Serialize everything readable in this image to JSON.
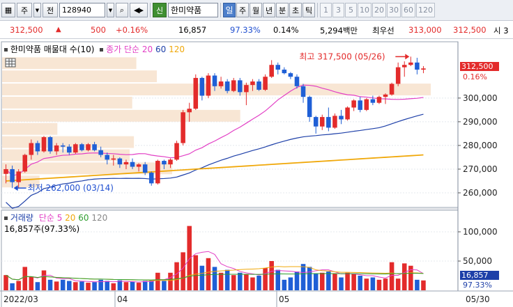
{
  "toolbar": {
    "type_label": "주",
    "jeon_label": "전",
    "code_value": "128940",
    "shin_label": "신",
    "stock_name": "한미약품",
    "periods": [
      "일",
      "주",
      "월",
      "년",
      "분",
      "초",
      "틱"
    ],
    "active_period": "일",
    "intervals": [
      "1",
      "3",
      "5",
      "10",
      "20",
      "30",
      "60",
      "120"
    ]
  },
  "quote": {
    "price": "312,500",
    "change": "500",
    "change_pct": "+0.16%",
    "volume": "16,857",
    "vol_ratio": "97.33%",
    "turnover": "0.14%",
    "amount": "5,294백만",
    "best_bid_label": "최우선",
    "best_ask": "313,000",
    "best_bid": "312,500",
    "extra": "시 3"
  },
  "price_panel": {
    "legend_title": "한미약품 매물대 수(10)",
    "ma_label": "종가 단순",
    "ma_periods": [
      "20",
      "60",
      "120"
    ],
    "ma_colors": [
      "#e23fc5",
      "#1d3fa8",
      "#f0a80a"
    ],
    "high_label": "최고 317,500 (05/26)",
    "low_label": "최저 262,000 (03/14)",
    "current_price": "312,500",
    "current_pct": "0.16%",
    "y_ticks": [
      "300,000",
      "290,000",
      "280,000",
      "270,000",
      "260,000"
    ]
  },
  "volume_panel": {
    "legend_title": "거래량",
    "ma_label": "단순",
    "ma_periods": [
      "5",
      "20",
      "60",
      "120"
    ],
    "ma_colors": [
      "#e23fc5",
      "#f0a80a",
      "#2f9e2f",
      "#888888"
    ],
    "current_text": "16,857주(97.33%)",
    "current_volume": "16,857",
    "current_pct": "97.33%",
    "y_ticks": [
      "100,000",
      "50,000"
    ]
  },
  "x_axis": {
    "labels": [
      "2022/03",
      "04",
      "05"
    ],
    "right_label": "05/30"
  },
  "chart_data": {
    "type": "candlestick",
    "ylim": [
      255000,
      322000
    ],
    "volume_ylim": [
      0,
      125000
    ],
    "candles": [
      [
        268000,
        272000,
        264000,
        270000,
        26000
      ],
      [
        270000,
        271500,
        262000,
        264500,
        12000
      ],
      [
        264500,
        270000,
        262000,
        269000,
        16000
      ],
      [
        269000,
        276500,
        268500,
        276000,
        40000
      ],
      [
        276000,
        282500,
        274000,
        281000,
        23000
      ],
      [
        281000,
        282000,
        276000,
        277500,
        14000
      ],
      [
        277500,
        284000,
        277000,
        283500,
        34000
      ],
      [
        283500,
        284000,
        276500,
        277500,
        18000
      ],
      [
        277500,
        281000,
        276000,
        280000,
        15000
      ],
      [
        280000,
        281000,
        277000,
        279500,
        18000
      ],
      [
        279500,
        280500,
        276000,
        277000,
        16000
      ],
      [
        277000,
        281000,
        276500,
        280500,
        14000
      ],
      [
        280500,
        281000,
        277500,
        278000,
        15000
      ],
      [
        278000,
        281000,
        277500,
        280500,
        13000
      ],
      [
        280500,
        281500,
        277500,
        278000,
        14000
      ],
      [
        278000,
        279500,
        275000,
        276000,
        18000
      ],
      [
        276000,
        277000,
        272000,
        274000,
        16000
      ],
      [
        274000,
        276000,
        271500,
        274500,
        12000
      ],
      [
        274500,
        275000,
        270500,
        272000,
        17000
      ],
      [
        272000,
        274000,
        270000,
        273000,
        14000
      ],
      [
        273000,
        274500,
        270000,
        271000,
        15000
      ],
      [
        271000,
        272500,
        269000,
        272000,
        13000
      ],
      [
        272000,
        273000,
        267500,
        268500,
        16000
      ],
      [
        268500,
        269000,
        263000,
        264000,
        16000
      ],
      [
        264000,
        274000,
        263500,
        273500,
        30000
      ],
      [
        273500,
        274000,
        270000,
        272000,
        16000
      ],
      [
        272000,
        274500,
        270500,
        274000,
        30000
      ],
      [
        274000,
        282000,
        273500,
        281000,
        48000
      ],
      [
        281000,
        295000,
        280000,
        294000,
        65000
      ],
      [
        294000,
        298000,
        290000,
        295500,
        110000
      ],
      [
        295500,
        310000,
        295000,
        308500,
        60000
      ],
      [
        308500,
        309000,
        299000,
        301000,
        42000
      ],
      [
        301000,
        310500,
        300000,
        309500,
        55000
      ],
      [
        309500,
        310500,
        303000,
        305000,
        40000
      ],
      [
        305000,
        309000,
        304000,
        307000,
        30000
      ],
      [
        307000,
        308000,
        302000,
        303000,
        35000
      ],
      [
        303000,
        308500,
        302500,
        307500,
        26000
      ],
      [
        307500,
        308500,
        301000,
        302500,
        30000
      ],
      [
        302500,
        306500,
        297000,
        305500,
        28000
      ],
      [
        305500,
        308000,
        303000,
        307000,
        22000
      ],
      [
        307000,
        308000,
        303000,
        303500,
        25000
      ],
      [
        303500,
        310000,
        303000,
        309000,
        38000
      ],
      [
        309000,
        316000,
        308500,
        314000,
        50000
      ],
      [
        314000,
        315000,
        310000,
        312000,
        35000
      ],
      [
        312000,
        313000,
        310000,
        310500,
        18000
      ],
      [
        310500,
        311000,
        308000,
        309000,
        22000
      ],
      [
        309000,
        310000,
        304000,
        305000,
        32000
      ],
      [
        305000,
        306000,
        298000,
        300500,
        45000
      ],
      [
        300500,
        301000,
        290000,
        292000,
        40000
      ],
      [
        292000,
        292500,
        285000,
        288000,
        28000
      ],
      [
        288000,
        293000,
        286500,
        292000,
        30000
      ],
      [
        292000,
        296000,
        286000,
        287500,
        32000
      ],
      [
        287500,
        293500,
        287000,
        292500,
        28000
      ],
      [
        292500,
        295000,
        289000,
        291000,
        22000
      ],
      [
        291000,
        296500,
        290500,
        296000,
        30000
      ],
      [
        296000,
        299500,
        294500,
        299000,
        28000
      ],
      [
        299000,
        300500,
        294000,
        295000,
        25000
      ],
      [
        295000,
        300000,
        294500,
        299500,
        20000
      ],
      [
        299500,
        301000,
        297000,
        298000,
        22000
      ],
      [
        298000,
        301000,
        297500,
        300500,
        18000
      ],
      [
        300500,
        302000,
        297500,
        301500,
        20000
      ],
      [
        301500,
        306500,
        301000,
        306000,
        48000
      ],
      [
        306000,
        315000,
        305000,
        313000,
        20000
      ],
      [
        313000,
        315500,
        309000,
        314000,
        46000
      ],
      [
        314000,
        317500,
        313500,
        315000,
        42000
      ],
      [
        315000,
        317000,
        310000,
        312000,
        18000
      ],
      [
        312000,
        313500,
        310500,
        312500,
        16857
      ]
    ]
  }
}
